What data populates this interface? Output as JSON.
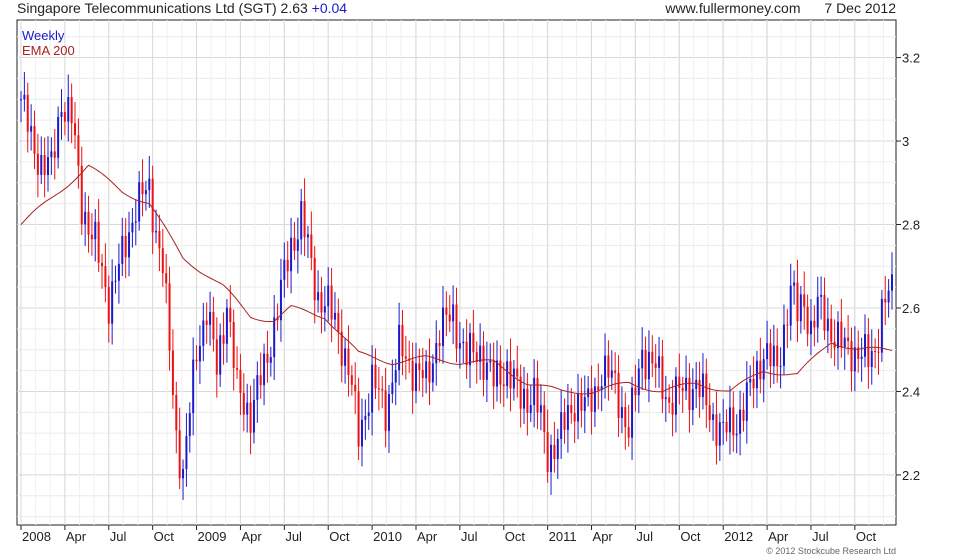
{
  "header": {
    "title": "Singapore Telecommunications Ltd (SGT) 2.63",
    "change": "+0.04",
    "website": "www.fullermoney.com",
    "date": "7 Dec 2012"
  },
  "legend": {
    "series1": "Weekly",
    "series2": "EMA 200"
  },
  "copyright": "© 2012 Stockcube Research Ltd",
  "colors": {
    "up": "#1a1acc",
    "down": "#ee1111",
    "ema": "#aa2222",
    "grid": "#d9d9d9"
  },
  "chart_data": {
    "type": "line",
    "ylim": [
      2.08,
      3.29
    ],
    "y_ticks": [
      2.2,
      2.4,
      2.6,
      2.8,
      3,
      3.2
    ],
    "y_tick_labels": [
      "2.2",
      "2.4",
      "2.6",
      "2.8",
      "3",
      "3.2"
    ],
    "x_tick_labels": [
      "2008",
      "Apr",
      "Jul",
      "Oct",
      "2009",
      "Apr",
      "Jul",
      "Oct",
      "2010",
      "Apr",
      "Jul",
      "Oct",
      "2011",
      "Apr",
      "Jul",
      "Oct",
      "2012",
      "Apr",
      "Jul",
      "Oct"
    ],
    "x_range_weeks": [
      0,
      258
    ],
    "series": [
      {
        "name": "Weekly",
        "x_week": [
          0,
          3,
          6,
          9,
          12,
          15,
          18,
          22,
          26,
          30,
          34,
          38,
          42,
          44,
          46,
          48,
          50,
          52,
          55,
          58,
          61,
          64,
          68,
          72,
          76,
          80,
          83,
          86,
          88,
          91,
          94,
          97,
          100,
          104,
          108,
          112,
          116,
          120,
          124,
          128,
          132,
          136,
          140,
          144,
          148,
          152,
          156,
          160,
          164,
          168,
          172,
          176,
          180,
          184,
          188,
          192,
          196,
          200,
          204,
          208,
          212,
          216,
          220,
          224,
          228,
          230,
          232,
          234,
          236,
          240,
          244,
          248,
          251,
          253,
          255,
          257
        ],
        "close": [
          3.1,
          3.0,
          2.95,
          2.93,
          3.1,
          3.05,
          2.85,
          2.75,
          2.62,
          2.72,
          2.85,
          2.88,
          2.7,
          2.5,
          2.3,
          2.2,
          2.35,
          2.5,
          2.6,
          2.45,
          2.62,
          2.4,
          2.35,
          2.45,
          2.6,
          2.75,
          2.82,
          2.7,
          2.63,
          2.6,
          2.55,
          2.45,
          2.3,
          2.42,
          2.36,
          2.5,
          2.46,
          2.42,
          2.55,
          2.58,
          2.48,
          2.5,
          2.42,
          2.46,
          2.38,
          2.4,
          2.25,
          2.3,
          2.38,
          2.36,
          2.45,
          2.42,
          2.3,
          2.5,
          2.45,
          2.38,
          2.4,
          2.42,
          2.35,
          2.3,
          2.33,
          2.4,
          2.5,
          2.45,
          2.65,
          2.58,
          2.62,
          2.55,
          2.6,
          2.55,
          2.5,
          2.5,
          2.47,
          2.5,
          2.6,
          2.63
        ]
      },
      {
        "name": "EMA 200",
        "x_week": [
          0,
          10,
          20,
          30,
          38,
          48,
          55,
          60,
          68,
          75,
          80,
          90,
          100,
          110,
          120,
          130,
          140,
          150,
          160,
          170,
          180,
          190,
          200,
          210,
          220,
          230,
          240,
          248,
          252,
          257
        ],
        "values": [
          2.8,
          2.87,
          2.94,
          2.88,
          2.85,
          2.72,
          2.68,
          2.65,
          2.58,
          2.57,
          2.6,
          2.58,
          2.49,
          2.47,
          2.48,
          2.47,
          2.47,
          2.42,
          2.4,
          2.4,
          2.42,
          2.4,
          2.42,
          2.4,
          2.45,
          2.44,
          2.52,
          2.5,
          2.5,
          2.5
        ]
      }
    ]
  }
}
